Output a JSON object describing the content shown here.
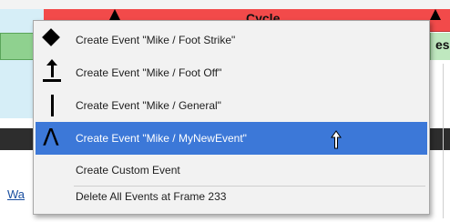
{
  "background": {
    "timeline_label": "Cycle",
    "right_edge_text": "es",
    "left_link_text": "Wa"
  },
  "menu": {
    "items": [
      {
        "label": "Create Event \"Mike / Foot Strike\"",
        "icon": "diamond-icon"
      },
      {
        "label": "Create Event \"Mike / Foot Off\"",
        "icon": "foot-off-arrow-icon"
      },
      {
        "label": "Create Event \"Mike / General\"",
        "icon": "vertical-line-icon"
      },
      {
        "label": "Create Event \"Mike / MyNewEvent\"",
        "icon": "lambda-icon",
        "highlighted": true
      },
      {
        "label": "Create Custom Event",
        "icon": ""
      },
      {
        "label": "Delete All Events at Frame 233",
        "icon": ""
      }
    ],
    "highlight_color": "#3c78d8"
  }
}
